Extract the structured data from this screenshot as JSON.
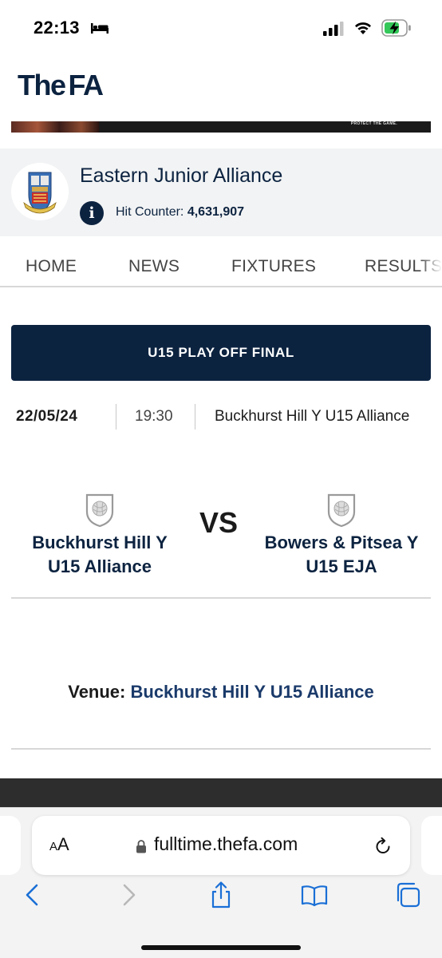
{
  "status_bar": {
    "time": "22:13"
  },
  "header": {
    "logo_the": "The",
    "logo_fa": "FA"
  },
  "banner": {
    "tag": "PROTECT THE GAME."
  },
  "league": {
    "name": "Eastern Junior Alliance",
    "hit_counter_label": "Hit Counter:",
    "hit_counter_value": "4,631,907"
  },
  "nav": {
    "tabs": [
      "HOME",
      "NEWS",
      "FIXTURES",
      "RESULTS"
    ]
  },
  "fixture": {
    "title": "U15 PLAY OFF FINAL",
    "date": "22/05/24",
    "time": "19:30",
    "location": "Buckhurst Hill Y U15 Alliance",
    "home_team": {
      "line1": "Buckhurst Hill Y",
      "line2": "U15 Alliance"
    },
    "away_team": {
      "line1": "Bowers & Pitsea Y",
      "line2": "U15 EJA"
    },
    "vs": "VS",
    "venue_label": "Venue:",
    "venue_value": "Buckhurst Hill Y U15 Alliance"
  },
  "browser": {
    "aa_small": "A",
    "aa_large": "A",
    "url": "fulltime.thefa.com"
  },
  "colors": {
    "navy": "#0c2340",
    "accent_blue": "#1a6fd6"
  }
}
